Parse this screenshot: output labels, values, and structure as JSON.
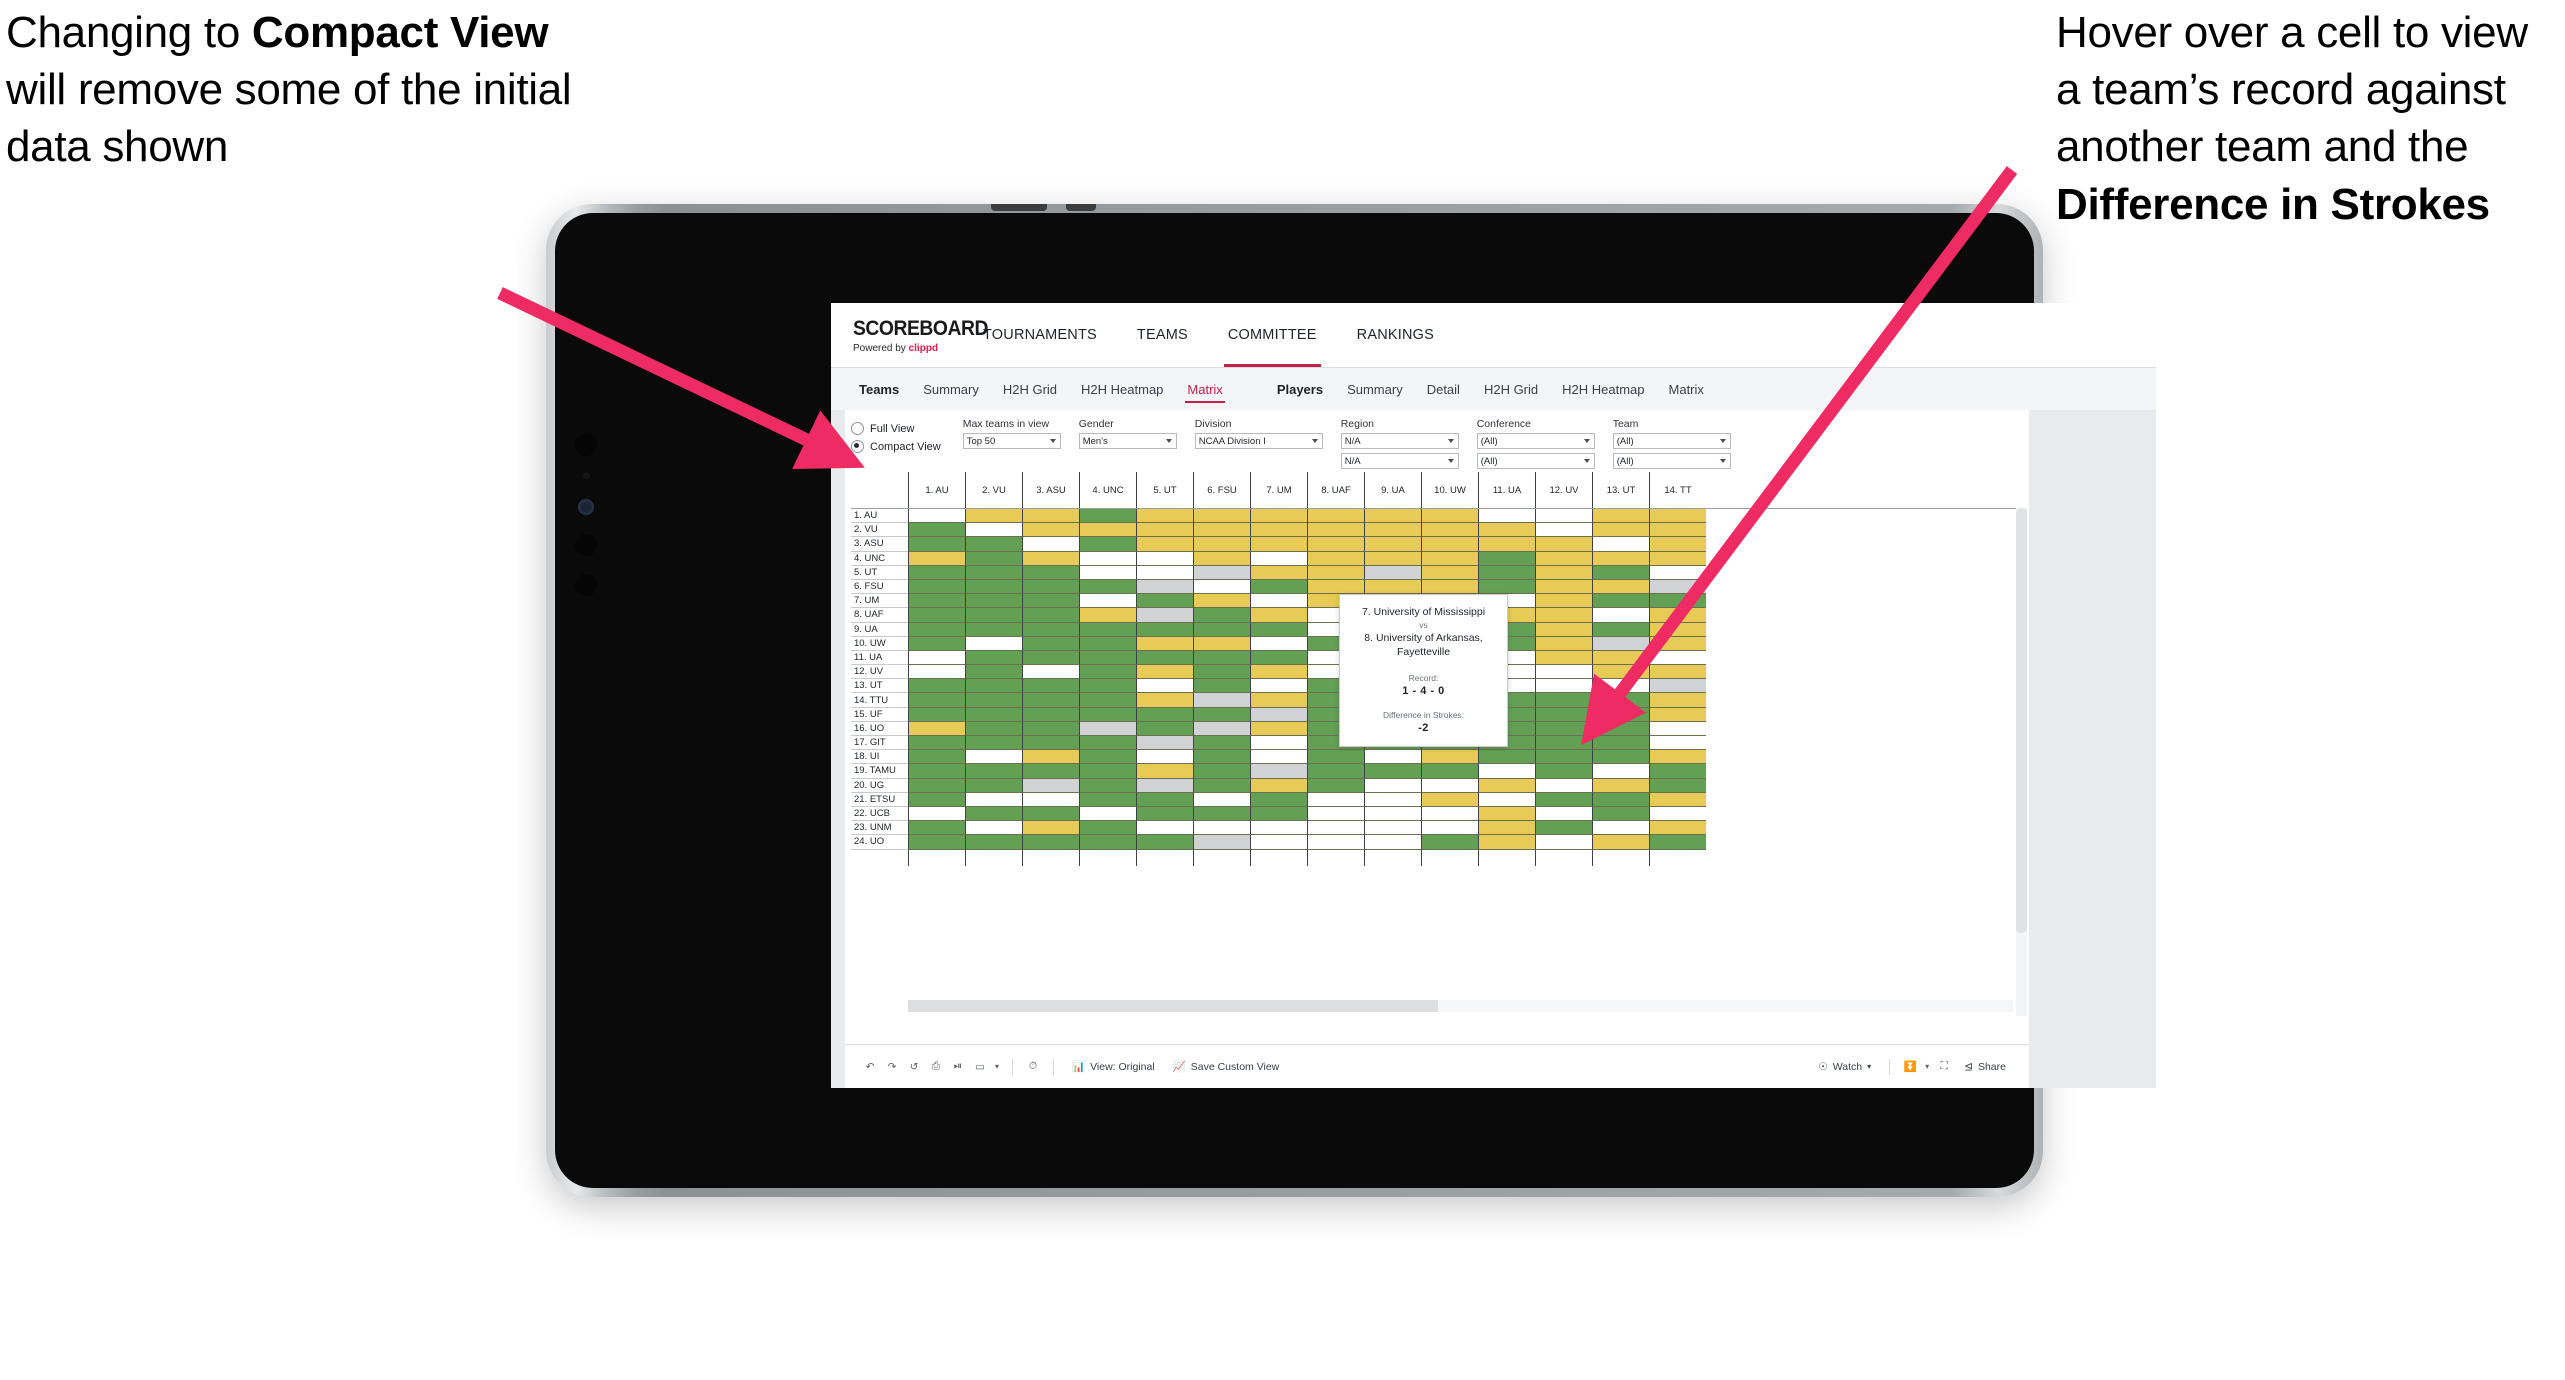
{
  "annotations": {
    "left": {
      "part1": "Changing to ",
      "bold": "Compact View",
      "part2": " will remove some of the initial data shown"
    },
    "right": {
      "part1": "Hover over a cell to view a team’s record against another team and the ",
      "bold": "Difference in Strokes",
      "part2": ""
    },
    "arrow_color": "#ee2b63"
  },
  "app": {
    "brand": {
      "title": "SCOREBOARD",
      "powered_prefix": "Powered by ",
      "powered_name": "clippd"
    },
    "topnav": [
      {
        "label": "TOURNAMENTS",
        "active": false
      },
      {
        "label": "TEAMS",
        "active": false
      },
      {
        "label": "COMMITTEE",
        "active": true
      },
      {
        "label": "RANKINGS",
        "active": false
      }
    ],
    "subnav": {
      "group1_title": "Teams",
      "group1_items": [
        {
          "label": "Summary",
          "active": false
        },
        {
          "label": "H2H Grid",
          "active": false
        },
        {
          "label": "H2H Heatmap",
          "active": false
        },
        {
          "label": "Matrix",
          "active": true
        }
      ],
      "group2_title": "Players",
      "group2_items": [
        {
          "label": "Summary",
          "active": false
        },
        {
          "label": "Detail",
          "active": false
        },
        {
          "label": "H2H Grid",
          "active": false
        },
        {
          "label": "H2H Heatmap",
          "active": false
        },
        {
          "label": "Matrix",
          "active": false
        }
      ]
    },
    "filters": {
      "view_options": [
        {
          "label": "Full View",
          "selected": false
        },
        {
          "label": "Compact View",
          "selected": true
        }
      ],
      "controls": [
        {
          "label": "Max teams in view",
          "value": "Top 50",
          "width": "narrow"
        },
        {
          "label": "Gender",
          "value": "Men's",
          "width": "narrow"
        },
        {
          "label": "Division",
          "value": "NCAA Division I",
          "width": "wide"
        }
      ],
      "stacked": [
        {
          "label": "Region",
          "values": [
            "N/A",
            "N/A"
          ]
        },
        {
          "label": "Conference",
          "values": [
            "(All)",
            "(All)"
          ]
        },
        {
          "label": "Team",
          "values": [
            "(All)",
            "(All)"
          ]
        }
      ]
    },
    "toolbar": {
      "icons": [
        "undo-icon",
        "redo-icon",
        "revert-icon",
        "refresh-icon",
        "pause-icon",
        "rect-select-icon"
      ],
      "view_label": "View: Original",
      "save_label": "Save Custom View",
      "watch_label": "Watch",
      "share_label": "Share"
    }
  },
  "tooltip": {
    "team_a": "7. University of Mississippi",
    "vs": "vs",
    "team_b": "8. University of Arkansas, Fayetteville",
    "record_label": "Record:",
    "record_value": "1 - 4 - 0",
    "diff_label": "Difference in Strokes:",
    "diff_value": "-2"
  },
  "matrix": {
    "columns": [
      "1. AU",
      "2. VU",
      "3. ASU",
      "4. UNC",
      "5. UT",
      "6. FSU",
      "7. UM",
      "8. UAF",
      "9. UA",
      "10. UW",
      "11. UA",
      "12. UV",
      "13. UT",
      "14. TT"
    ],
    "rows": [
      "1. AU",
      "2. VU",
      "3. ASU",
      "4. UNC",
      "5. UT",
      "6. FSU",
      "7. UM",
      "8. UAF",
      "9. UA",
      "10. UW",
      "11. UA",
      "12. UV",
      "13. UT",
      "14. TTU",
      "15. UF",
      "16. UO",
      "17. GIT",
      "18. UI",
      "19. TAMU",
      "20. UG",
      "21. ETSU",
      "22. UCB",
      "23. UNM",
      "24. UO"
    ],
    "legend": {
      "win": "#63a054",
      "loss": "#e8cb56",
      "tie": "#d0d2d4",
      "none": "#ffffff"
    },
    "cells": [
      [
        "w",
        "y",
        "y",
        "g",
        "y",
        "y",
        "y",
        "y",
        "y",
        "y",
        "w",
        "w",
        "y",
        "y"
      ],
      [
        "g",
        "w",
        "y",
        "y",
        "y",
        "y",
        "y",
        "y",
        "y",
        "y",
        "y",
        "w",
        "y",
        "y"
      ],
      [
        "g",
        "g",
        "w",
        "g",
        "y",
        "y",
        "y",
        "y",
        "y",
        "y",
        "y",
        "y",
        "w",
        "y"
      ],
      [
        "y",
        "g",
        "y",
        "w",
        "w",
        "y",
        "w",
        "y",
        "y",
        "y",
        "g",
        "y",
        "y",
        "y"
      ],
      [
        "g",
        "g",
        "g",
        "w",
        "w",
        "k",
        "y",
        "y",
        "k",
        "y",
        "g",
        "y",
        "g",
        "w"
      ],
      [
        "g",
        "g",
        "g",
        "g",
        "k",
        "w",
        "g",
        "y",
        "y",
        "y",
        "g",
        "y",
        "y",
        "k"
      ],
      [
        "g",
        "g",
        "g",
        "w",
        "g",
        "y",
        "w",
        "y",
        "g",
        "y",
        "w",
        "y",
        "g",
        "g"
      ],
      [
        "g",
        "g",
        "g",
        "y",
        "k",
        "g",
        "y",
        "w",
        "w",
        "y",
        "y",
        "y",
        "w",
        "y"
      ],
      [
        "g",
        "g",
        "g",
        "g",
        "g",
        "g",
        "g",
        "w",
        "w",
        "y",
        "g",
        "y",
        "g",
        "y"
      ],
      [
        "g",
        "w",
        "g",
        "g",
        "y",
        "y",
        "w",
        "g",
        "y",
        "w",
        "g",
        "y",
        "k",
        "y"
      ],
      [
        "w",
        "g",
        "g",
        "g",
        "g",
        "g",
        "g",
        "w",
        "w",
        "w",
        "w",
        "y",
        "y",
        "w"
      ],
      [
        "w",
        "g",
        "w",
        "g",
        "y",
        "g",
        "y",
        "w",
        "w",
        "w",
        "w",
        "w",
        "y",
        "y"
      ],
      [
        "g",
        "g",
        "g",
        "g",
        "w",
        "g",
        "w",
        "g",
        "y",
        "g",
        "w",
        "w",
        "w",
        "k"
      ],
      [
        "g",
        "g",
        "g",
        "g",
        "y",
        "k",
        "y",
        "g",
        "g",
        "g",
        "g",
        "g",
        "g",
        "y"
      ],
      [
        "g",
        "g",
        "g",
        "g",
        "g",
        "g",
        "k",
        "g",
        "g",
        "g",
        "g",
        "g",
        "g",
        "y"
      ],
      [
        "y",
        "g",
        "g",
        "k",
        "g",
        "k",
        "y",
        "g",
        "g",
        "g",
        "g",
        "g",
        "g",
        "w"
      ],
      [
        "g",
        "g",
        "g",
        "g",
        "k",
        "g",
        "w",
        "g",
        "g",
        "g",
        "g",
        "g",
        "g",
        "w"
      ],
      [
        "g",
        "w",
        "y",
        "g",
        "w",
        "g",
        "w",
        "g",
        "w",
        "y",
        "g",
        "g",
        "g",
        "y"
      ],
      [
        "g",
        "g",
        "g",
        "g",
        "y",
        "g",
        "k",
        "g",
        "g",
        "g",
        "w",
        "g",
        "w",
        "g"
      ],
      [
        "g",
        "g",
        "k",
        "g",
        "k",
        "g",
        "y",
        "g",
        "w",
        "w",
        "y",
        "w",
        "y",
        "g"
      ],
      [
        "g",
        "w",
        "w",
        "g",
        "g",
        "w",
        "g",
        "w",
        "w",
        "y",
        "w",
        "g",
        "g",
        "y"
      ],
      [
        "w",
        "g",
        "g",
        "w",
        "g",
        "g",
        "g",
        "w",
        "w",
        "w",
        "y",
        "w",
        "g",
        "w"
      ],
      [
        "g",
        "w",
        "y",
        "g",
        "w",
        "w",
        "w",
        "w",
        "w",
        "w",
        "y",
        "g",
        "w",
        "y"
      ],
      [
        "g",
        "g",
        "g",
        "g",
        "g",
        "k",
        "w",
        "w",
        "w",
        "g",
        "y",
        "w",
        "y",
        "g"
      ]
    ]
  }
}
